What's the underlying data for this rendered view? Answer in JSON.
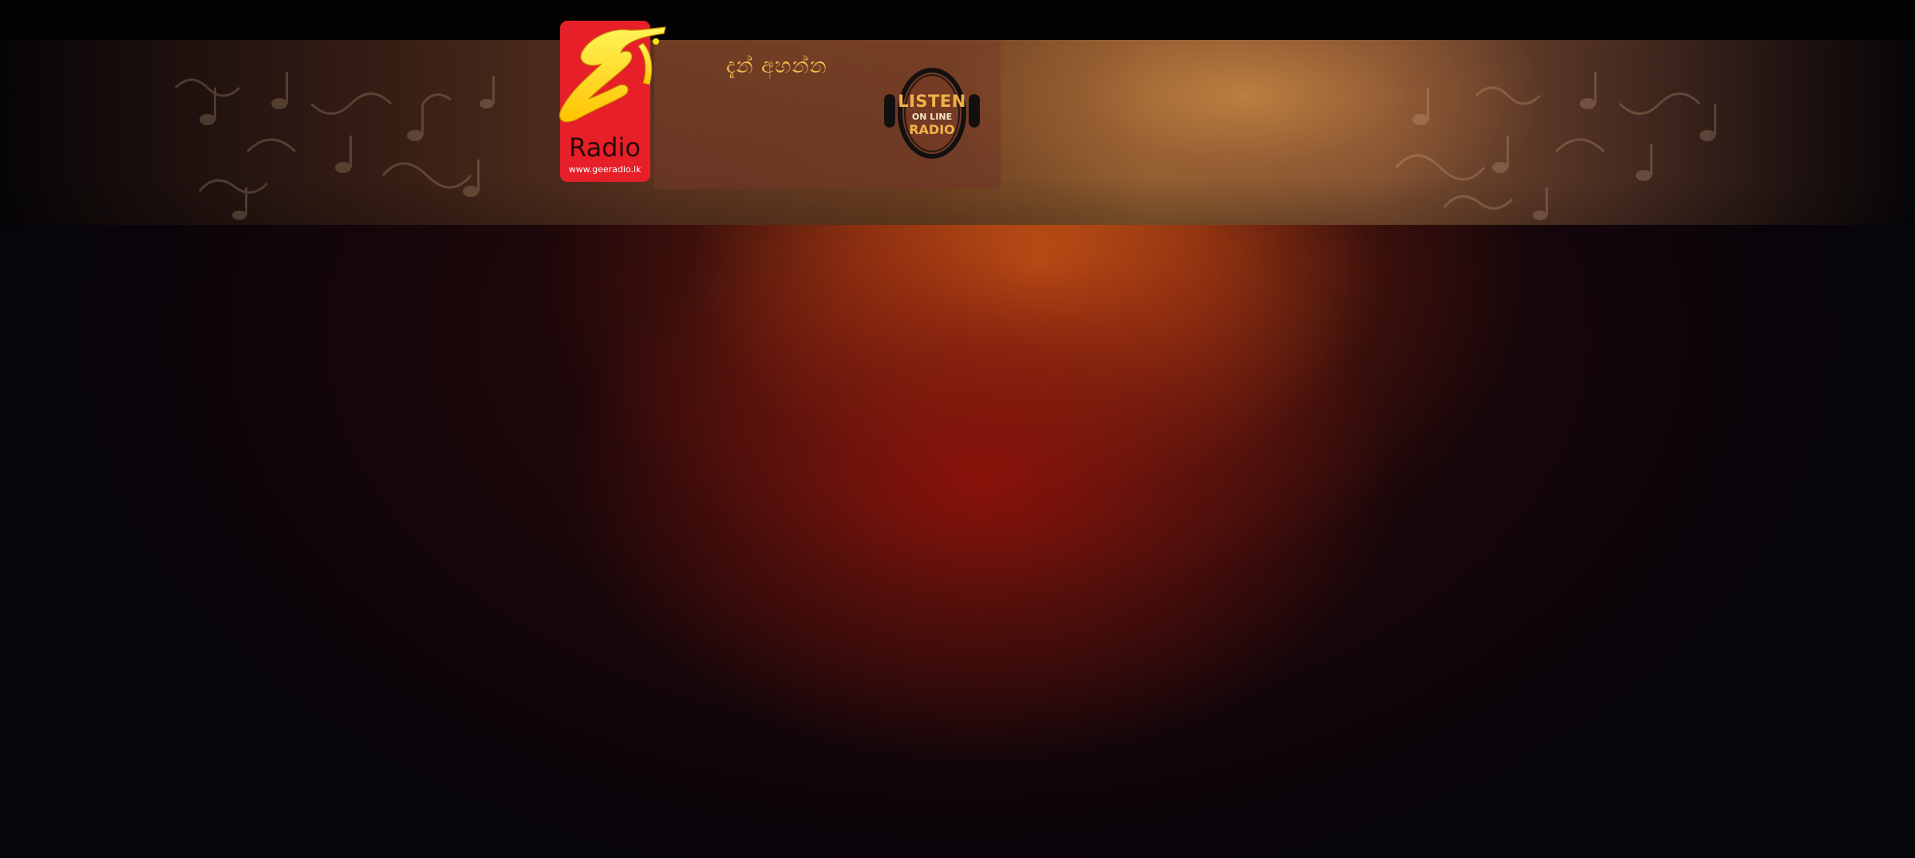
{
  "site": {
    "name": "Gee Radio",
    "accent_color": "#f2b650",
    "brand_red": "#e8202a",
    "brand_yellow": "#ffe200"
  },
  "logo": {
    "glyph": "ගී",
    "wordmark": "Radio",
    "url_text": "www.geeradio.lk"
  },
  "header": {
    "listen_now_label": "දැන් අහන්න"
  },
  "listen_badge": {
    "line1": "LISTEN",
    "line2": "ON LINE",
    "line3": "RADIO",
    "icon": "headphones-icon"
  }
}
